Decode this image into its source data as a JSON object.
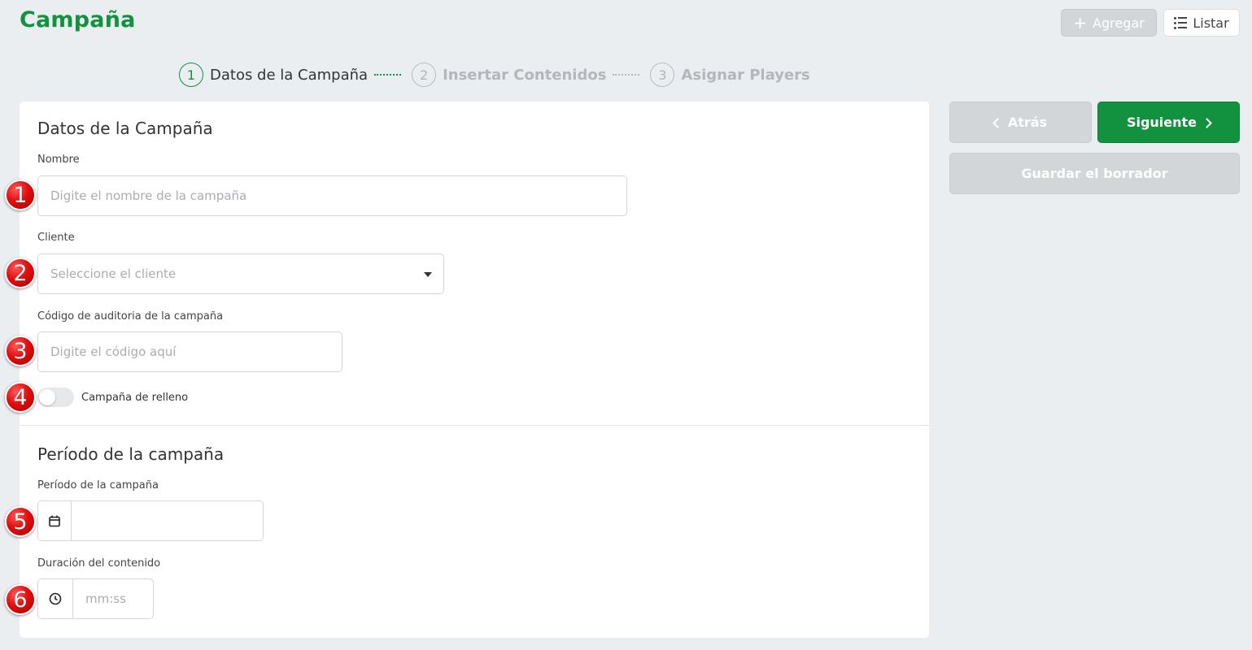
{
  "header": {
    "title": "Campaña",
    "add_label": "Agregar",
    "list_label": "Listar"
  },
  "stepper": {
    "steps": [
      {
        "number": "1",
        "label": "Datos de la Campaña"
      },
      {
        "number": "2",
        "label": "Insertar Contenidos"
      },
      {
        "number": "3",
        "label": "Asignar Players"
      }
    ]
  },
  "form": {
    "section1_title": "Datos de la Campaña",
    "name_label": "Nombre",
    "name_placeholder": "Digite el nombre de la campaña",
    "client_label": "Cliente",
    "client_placeholder": "Seleccione el cliente",
    "audit_label": "Código de auditoria de la campaña",
    "audit_placeholder": "Digite el código aquí",
    "fill_toggle_label": "Campaña de relleno",
    "fill_toggle_on": false,
    "section2_title": "Período de la campaña",
    "period_label": "Período de la campaña",
    "period_value": "",
    "duration_label": "Duración del contenido",
    "duration_placeholder": "mm:ss"
  },
  "side": {
    "back_label": "Atrás",
    "next_label": "Siguiente",
    "draft_label": "Guardar el borrador"
  },
  "markers": [
    "1",
    "2",
    "3",
    "4",
    "5",
    "6"
  ],
  "colors": {
    "brand_green": "#12913f",
    "marker_red": "#e10e0e",
    "disabled_grey": "#d3d6d9"
  }
}
